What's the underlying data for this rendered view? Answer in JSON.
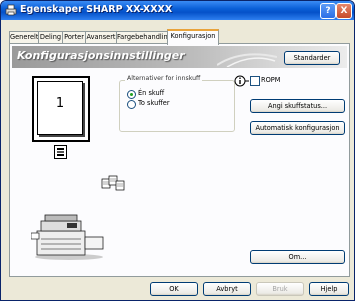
{
  "window": {
    "title": "Egenskaper SHARP XX-XXXX",
    "help_btn": "?",
    "close_btn": "X"
  },
  "tabs": [
    {
      "label": "Generelt"
    },
    {
      "label": "Deling"
    },
    {
      "label": "Porter"
    },
    {
      "label": "Avansert"
    },
    {
      "label": "Fargebehandling"
    },
    {
      "label": "Konfigurasjon",
      "active": true
    }
  ],
  "panel": {
    "heading": "Konfigurasjonsinnstillinger",
    "standard_btn": "Standarder",
    "preview_number": "1",
    "input_group": {
      "legend": "Alternativer for innskuff",
      "options": [
        {
          "label": "Én skuff",
          "selected": true
        },
        {
          "label": "To skuffer",
          "selected": false
        }
      ]
    },
    "ropm": {
      "label": "ROPM",
      "checked": false
    },
    "tray_status_btn": "Angi skuffstatus...",
    "auto_config_btn": "Automatisk konfigurasjon",
    "about_btn": "Om..."
  },
  "footer": {
    "ok": "OK",
    "cancel": "Avbryt",
    "apply": "Bruk",
    "help": "Hjelp"
  },
  "colors": {
    "titlebar": "#0a5fd8",
    "window_bg": "#ece9d8",
    "active_tab_accent": "#e9a33b"
  },
  "icons": [
    "printer-icon",
    "info-icon",
    "staple-icon",
    "sheets-icon",
    "copier-icon"
  ]
}
